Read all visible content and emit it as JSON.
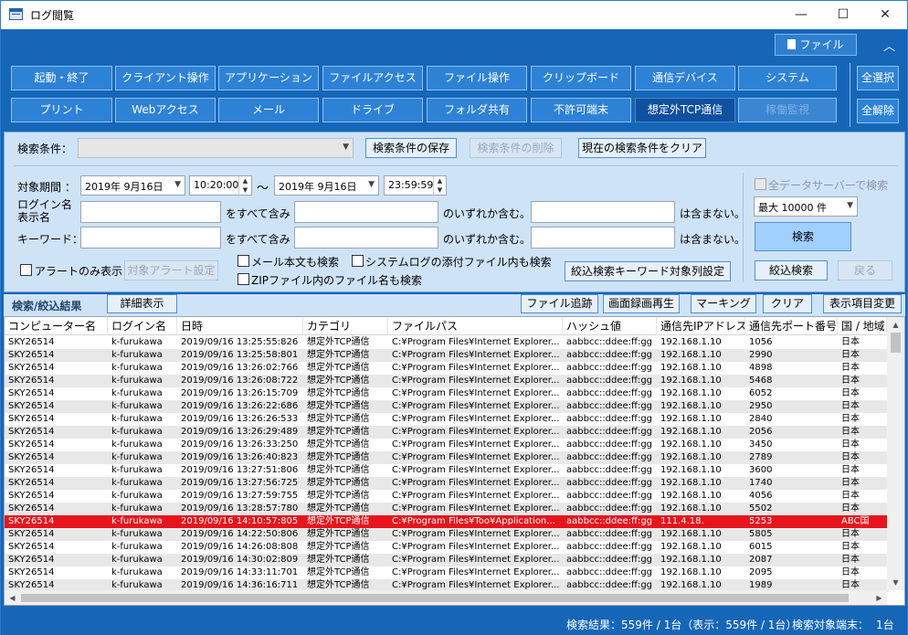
{
  "window": {
    "title": "ログ閲覧",
    "minimize": "—",
    "maximize": "☐",
    "close": "✕"
  },
  "header": {
    "file_button": "ファイル",
    "collapse": "︿"
  },
  "categories": {
    "row1": [
      "起動・終了",
      "クライアント操作",
      "アプリケーション",
      "ファイルアクセス",
      "ファイル操作",
      "クリップボード",
      "通信デバイス",
      "システム"
    ],
    "row2": [
      "プリント",
      "Webアクセス",
      "メール",
      "ドライブ",
      "フォルダ共有",
      "不許可端末",
      "想定外TCP通信",
      "稼働監視"
    ],
    "selected": "想定外TCP通信",
    "disabled": "稼働監視",
    "select_all": "全選択",
    "deselect_all": "全解除"
  },
  "search": {
    "condition_label": "検索条件：",
    "condition_value": "",
    "save_button": "検索条件の保存",
    "delete_button": "検索条件の削除",
    "clear_button": "現在の検索条件をクリア",
    "period_label": "対象期間 ：",
    "from_date": "2019年 9月16日",
    "from_time": "10:20:00",
    "tilde": "～",
    "to_date": "2019年 9月16日",
    "to_time": "23:59:59",
    "login_label_1": "ログイン名",
    "login_label_2": "表示名",
    "keyword_label": "キーワード：",
    "contains_all": "をすべて含み",
    "contains_any": "のいずれか含む。",
    "not_contains": "は含まない。",
    "login_all_value": "",
    "login_any_value": "",
    "login_not_value": "",
    "kw_all_value": "",
    "kw_any_value": "",
    "kw_not_value": "",
    "alert_only": "アラートのみ表示：",
    "alert_setting": "対象アラート設定",
    "mail_body": "メール本文も検索",
    "system_log_attach": "システムログの添付ファイル内も検索",
    "zip_filenames": "ZIPファイル内のファイル名も検索",
    "narrow_keyword_setting": "絞込検索キーワード対象列設定",
    "all_servers": "全データサーバーで検索",
    "max_count": "最大 10000 件",
    "search_button": "検索",
    "narrow_button": "絞込検索",
    "back_button": "戻る"
  },
  "results": {
    "title": "検索/絞込結果",
    "detail_button": "詳細表示",
    "file_trace": "ファイル追跡",
    "screen_replay": "画面録画再生",
    "marking": "マーキング",
    "clear": "クリア",
    "column_change": "表示項目変更",
    "columns": [
      "コンピューター名",
      "ログイン名",
      "日時",
      "カテゴリ",
      "ファイルパス",
      "ハッシュ値",
      "通信先IPアドレス",
      "通信先ポート番号",
      "国 / 地域"
    ],
    "rows": [
      [
        "SKY26514",
        "k-furukawa",
        "2019/09/16 13:25:55:826",
        "想定外TCP通信",
        "C:¥Program Files¥Internet Explorer...",
        "aabbcc::ddee:ff:gg",
        "192.168.1.10",
        "1056",
        "日本"
      ],
      [
        "SKY26514",
        "k-furukawa",
        "2019/09/16 13:25:58:801",
        "想定外TCP通信",
        "C:¥Program Files¥Internet Explorer...",
        "aabbcc::ddee:ff:gg",
        "192.168.1.10",
        "2990",
        "日本"
      ],
      [
        "SKY26514",
        "k-furukawa",
        "2019/09/16 13:26:02:766",
        "想定外TCP通信",
        "C:¥Program Files¥Internet Explorer...",
        "aabbcc::ddee:ff:gg",
        "192.168.1.10",
        "4898",
        "日本"
      ],
      [
        "SKY26514",
        "k-furukawa",
        "2019/09/16 13:26:08:722",
        "想定外TCP通信",
        "C:¥Program Files¥Internet Explorer...",
        "aabbcc::ddee:ff:gg",
        "192.168.1.10",
        "5468",
        "日本"
      ],
      [
        "SKY26514",
        "k-furukawa",
        "2019/09/16 13:26:15:709",
        "想定外TCP通信",
        "C:¥Program Files¥Internet Explorer...",
        "aabbcc::ddee:ff:gg",
        "192.168.1.10",
        "6052",
        "日本"
      ],
      [
        "SKY26514",
        "k-furukawa",
        "2019/09/16 13:26:22:686",
        "想定外TCP通信",
        "C:¥Program Files¥Internet Explorer...",
        "aabbcc::ddee:ff:gg",
        "192.168.1.10",
        "2950",
        "日本"
      ],
      [
        "SKY26514",
        "k-furukawa",
        "2019/09/16 13:26:26:533",
        "想定外TCP通信",
        "C:¥Program Files¥Internet Explorer...",
        "aabbcc::ddee:ff:gg",
        "192.168.1.10",
        "2840",
        "日本"
      ],
      [
        "SKY26514",
        "k-furukawa",
        "2019/09/16 13:26:29:489",
        "想定外TCP通信",
        "C:¥Program Files¥Internet Explorer...",
        "aabbcc::ddee:ff:gg",
        "192.168.1.10",
        "2056",
        "日本"
      ],
      [
        "SKY26514",
        "k-furukawa",
        "2019/09/16 13:26:33:250",
        "想定外TCP通信",
        "C:¥Program Files¥Internet Explorer...",
        "aabbcc::ddee:ff:gg",
        "192.168.1.10",
        "3450",
        "日本"
      ],
      [
        "SKY26514",
        "k-furukawa",
        "2019/09/16 13:26:40:823",
        "想定外TCP通信",
        "C:¥Program Files¥Internet Explorer...",
        "aabbcc::ddee:ff:gg",
        "192.168.1.10",
        "2789",
        "日本"
      ],
      [
        "SKY26514",
        "k-furukawa",
        "2019/09/16 13:27:51:806",
        "想定外TCP通信",
        "C:¥Program Files¥Internet Explorer...",
        "aabbcc::ddee:ff:gg",
        "192.168.1.10",
        "3600",
        "日本"
      ],
      [
        "SKY26514",
        "k-furukawa",
        "2019/09/16 13:27:56:725",
        "想定外TCP通信",
        "C:¥Program Files¥Internet Explorer...",
        "aabbcc::ddee:ff:gg",
        "192.168.1.10",
        "1740",
        "日本"
      ],
      [
        "SKY26514",
        "k-furukawa",
        "2019/09/16 13:27:59:755",
        "想定外TCP通信",
        "C:¥Program Files¥Internet Explorer...",
        "aabbcc::ddee:ff:gg",
        "192.168.1.10",
        "4056",
        "日本"
      ],
      [
        "SKY26514",
        "k-furukawa",
        "2019/09/16 13:28:57:780",
        "想定外TCP通信",
        "C:¥Program Files¥Internet Explorer...",
        "aabbcc::ddee:ff:gg",
        "192.168.1.10",
        "5502",
        "日本"
      ],
      [
        "SKY26514",
        "k-furukawa",
        "2019/09/16 14:10:57:805",
        "想定外TCP通信",
        "C:¥Program Files¥Too¥Application...",
        "aabbcc::ddee:ff:gg",
        "111.4.18.",
        "5253",
        "ABC国"
      ],
      [
        "SKY26514",
        "k-furukawa",
        "2019/09/16 14:22:50:806",
        "想定外TCP通信",
        "C:¥Program Files¥Internet Explorer...",
        "aabbcc::ddee:ff:gg",
        "192.168.1.10",
        "5805",
        "日本"
      ],
      [
        "SKY26514",
        "k-furukawa",
        "2019/09/16 14:26:08:808",
        "想定外TCP通信",
        "C:¥Program Files¥Internet Explorer...",
        "aabbcc::ddee:ff:gg",
        "192.168.1.10",
        "6015",
        "日本"
      ],
      [
        "SKY26514",
        "k-furukawa",
        "2019/09/16 14:30:02:809",
        "想定外TCP通信",
        "C:¥Program Files¥Internet Explorer...",
        "aabbcc::ddee:ff:gg",
        "192.168.1.10",
        "2087",
        "日本"
      ],
      [
        "SKY26514",
        "k-furukawa",
        "2019/09/16 14:33:11:701",
        "想定外TCP通信",
        "C:¥Program Files¥Internet Explorer...",
        "aabbcc::ddee:ff:gg",
        "192.168.1.10",
        "2095",
        "日本"
      ],
      [
        "SKY26514",
        "k-furukawa",
        "2019/09/16 14:36:16:711",
        "想定外TCP通信",
        "C:¥Program Files¥Internet Explorer...",
        "aabbcc::ddee:ff:gg",
        "192.168.1.10",
        "1989",
        "日本"
      ]
    ],
    "highlight_row": 14,
    "highlight_color": "#e8141c"
  },
  "status": {
    "search_result": "検索結果：559件 / 1台（表示：559件 / 1台）",
    "target_terminals": "検索対象端末：",
    "target_count": "1台"
  }
}
